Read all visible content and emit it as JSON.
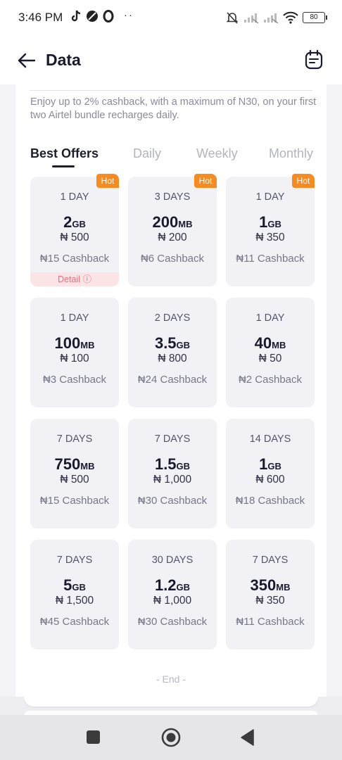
{
  "status_bar": {
    "time": "3:46 PM",
    "dots": "··",
    "battery": "80",
    "icons": [
      "tiktok-icon",
      "blocked-icon",
      "opera-icon",
      "mute-bell-icon",
      "signal-icon",
      "signal-icon",
      "wifi-icon",
      "battery-icon"
    ]
  },
  "header": {
    "title": "Data",
    "back_icon": "arrow-left-icon",
    "action_icon": "note-icon"
  },
  "intro": {
    "text": "Enjoy up to 2% cashback, with a maximum of N30, on your first two Airtel bundle recharges daily."
  },
  "tabs": [
    {
      "label": "Best Offers",
      "active": true
    },
    {
      "label": "Daily",
      "active": false
    },
    {
      "label": "Weekly",
      "active": false
    },
    {
      "label": "Monthly",
      "active": false
    }
  ],
  "offers": [
    {
      "days": "1 DAY",
      "amount": "2",
      "unit": "GB",
      "price": "₦ 500",
      "cashback": "₦15 Cashback",
      "hot": "Hot",
      "detail": "Detail ⓘ"
    },
    {
      "days": "3 DAYS",
      "amount": "200",
      "unit": "MB",
      "price": "₦ 200",
      "cashback": "₦6 Cashback",
      "hot": "Hot"
    },
    {
      "days": "1 DAY",
      "amount": "1",
      "unit": "GB",
      "price": "₦ 350",
      "cashback": "₦11 Cashback",
      "hot": "Hot"
    },
    {
      "days": "1 DAY",
      "amount": "100",
      "unit": "MB",
      "price": "₦ 100",
      "cashback": "₦3 Cashback"
    },
    {
      "days": "2 DAYS",
      "amount": "3.5",
      "unit": "GB",
      "price": "₦ 800",
      "cashback": "₦24 Cashback"
    },
    {
      "days": "1 DAY",
      "amount": "40",
      "unit": "MB",
      "price": "₦ 50",
      "cashback": "₦2 Cashback"
    },
    {
      "days": "7 DAYS",
      "amount": "750",
      "unit": "MB",
      "price": "₦ 500",
      "cashback": "₦15 Cashback"
    },
    {
      "days": "7 DAYS",
      "amount": "1.5",
      "unit": "GB",
      "price": "₦ 1,000",
      "cashback": "₦30 Cashback"
    },
    {
      "days": "14 DAYS",
      "amount": "1",
      "unit": "GB",
      "price": "₦ 600",
      "cashback": "₦18 Cashback"
    },
    {
      "days": "7 DAYS",
      "amount": "5",
      "unit": "GB",
      "price": "₦ 1,500",
      "cashback": "₦45 Cashback"
    },
    {
      "days": "30 DAYS",
      "amount": "1.2",
      "unit": "GB",
      "price": "₦ 1,000",
      "cashback": "₦30 Cashback"
    },
    {
      "days": "7 DAYS",
      "amount": "350",
      "unit": "MB",
      "price": "₦ 350",
      "cashback": "₦11 Cashback"
    }
  ],
  "end_text": "- End -",
  "colors": {
    "hot_badge": "#f68b1f",
    "card_bg": "#f1f1f6",
    "detail_bg": "#fbe3e6",
    "detail_text": "#e2717f",
    "accent_text": "#1e1e2e"
  },
  "nav_bar": {
    "icons": [
      "recents-square-icon",
      "home-circle-icon",
      "back-triangle-icon"
    ]
  }
}
